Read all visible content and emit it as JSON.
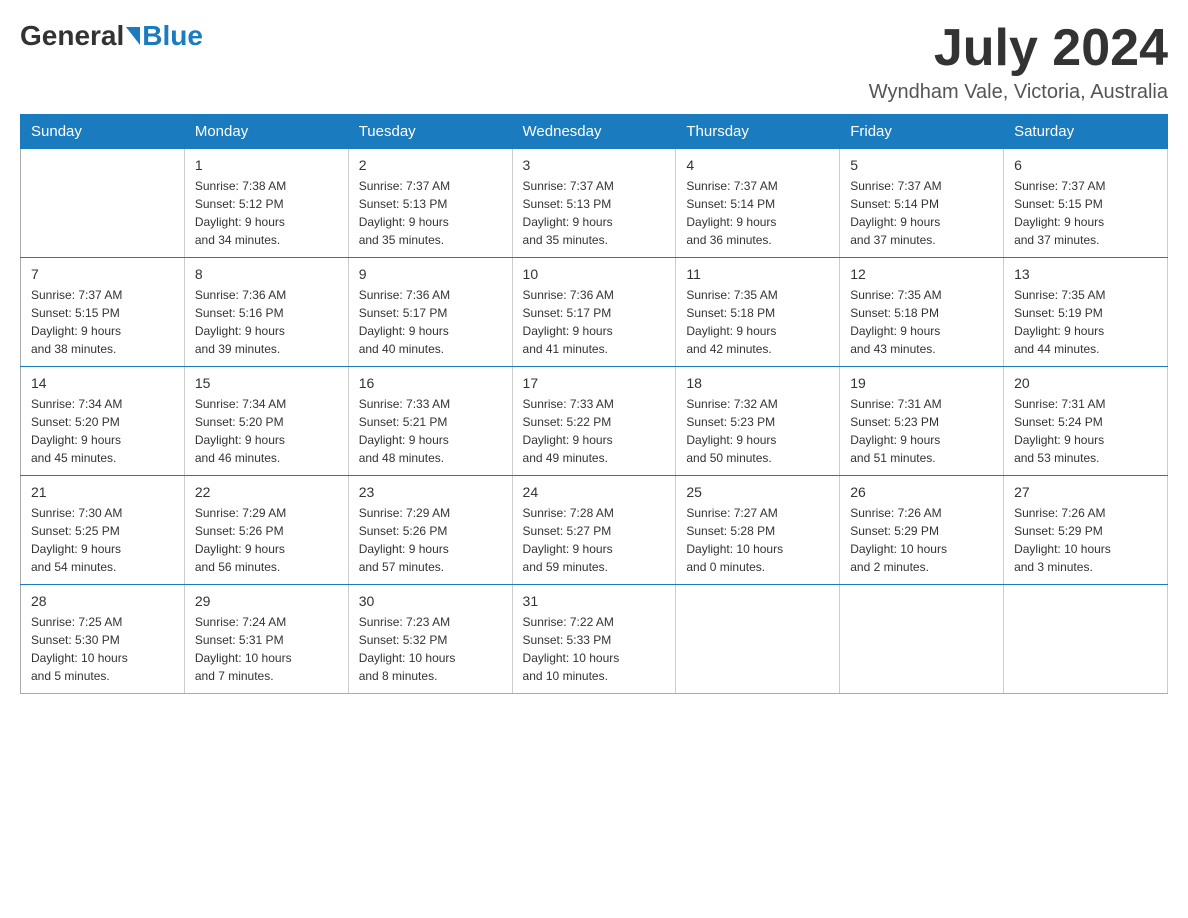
{
  "header": {
    "logo_general": "General",
    "logo_blue": "Blue",
    "month_title": "July 2024",
    "location": "Wyndham Vale, Victoria, Australia"
  },
  "weekdays": [
    "Sunday",
    "Monday",
    "Tuesday",
    "Wednesday",
    "Thursday",
    "Friday",
    "Saturday"
  ],
  "weeks": [
    [
      {
        "day": "",
        "info": ""
      },
      {
        "day": "1",
        "info": "Sunrise: 7:38 AM\nSunset: 5:12 PM\nDaylight: 9 hours\nand 34 minutes."
      },
      {
        "day": "2",
        "info": "Sunrise: 7:37 AM\nSunset: 5:13 PM\nDaylight: 9 hours\nand 35 minutes."
      },
      {
        "day": "3",
        "info": "Sunrise: 7:37 AM\nSunset: 5:13 PM\nDaylight: 9 hours\nand 35 minutes."
      },
      {
        "day": "4",
        "info": "Sunrise: 7:37 AM\nSunset: 5:14 PM\nDaylight: 9 hours\nand 36 minutes."
      },
      {
        "day": "5",
        "info": "Sunrise: 7:37 AM\nSunset: 5:14 PM\nDaylight: 9 hours\nand 37 minutes."
      },
      {
        "day": "6",
        "info": "Sunrise: 7:37 AM\nSunset: 5:15 PM\nDaylight: 9 hours\nand 37 minutes."
      }
    ],
    [
      {
        "day": "7",
        "info": "Sunrise: 7:37 AM\nSunset: 5:15 PM\nDaylight: 9 hours\nand 38 minutes."
      },
      {
        "day": "8",
        "info": "Sunrise: 7:36 AM\nSunset: 5:16 PM\nDaylight: 9 hours\nand 39 minutes."
      },
      {
        "day": "9",
        "info": "Sunrise: 7:36 AM\nSunset: 5:17 PM\nDaylight: 9 hours\nand 40 minutes."
      },
      {
        "day": "10",
        "info": "Sunrise: 7:36 AM\nSunset: 5:17 PM\nDaylight: 9 hours\nand 41 minutes."
      },
      {
        "day": "11",
        "info": "Sunrise: 7:35 AM\nSunset: 5:18 PM\nDaylight: 9 hours\nand 42 minutes."
      },
      {
        "day": "12",
        "info": "Sunrise: 7:35 AM\nSunset: 5:18 PM\nDaylight: 9 hours\nand 43 minutes."
      },
      {
        "day": "13",
        "info": "Sunrise: 7:35 AM\nSunset: 5:19 PM\nDaylight: 9 hours\nand 44 minutes."
      }
    ],
    [
      {
        "day": "14",
        "info": "Sunrise: 7:34 AM\nSunset: 5:20 PM\nDaylight: 9 hours\nand 45 minutes."
      },
      {
        "day": "15",
        "info": "Sunrise: 7:34 AM\nSunset: 5:20 PM\nDaylight: 9 hours\nand 46 minutes."
      },
      {
        "day": "16",
        "info": "Sunrise: 7:33 AM\nSunset: 5:21 PM\nDaylight: 9 hours\nand 48 minutes."
      },
      {
        "day": "17",
        "info": "Sunrise: 7:33 AM\nSunset: 5:22 PM\nDaylight: 9 hours\nand 49 minutes."
      },
      {
        "day": "18",
        "info": "Sunrise: 7:32 AM\nSunset: 5:23 PM\nDaylight: 9 hours\nand 50 minutes."
      },
      {
        "day": "19",
        "info": "Sunrise: 7:31 AM\nSunset: 5:23 PM\nDaylight: 9 hours\nand 51 minutes."
      },
      {
        "day": "20",
        "info": "Sunrise: 7:31 AM\nSunset: 5:24 PM\nDaylight: 9 hours\nand 53 minutes."
      }
    ],
    [
      {
        "day": "21",
        "info": "Sunrise: 7:30 AM\nSunset: 5:25 PM\nDaylight: 9 hours\nand 54 minutes."
      },
      {
        "day": "22",
        "info": "Sunrise: 7:29 AM\nSunset: 5:26 PM\nDaylight: 9 hours\nand 56 minutes."
      },
      {
        "day": "23",
        "info": "Sunrise: 7:29 AM\nSunset: 5:26 PM\nDaylight: 9 hours\nand 57 minutes."
      },
      {
        "day": "24",
        "info": "Sunrise: 7:28 AM\nSunset: 5:27 PM\nDaylight: 9 hours\nand 59 minutes."
      },
      {
        "day": "25",
        "info": "Sunrise: 7:27 AM\nSunset: 5:28 PM\nDaylight: 10 hours\nand 0 minutes."
      },
      {
        "day": "26",
        "info": "Sunrise: 7:26 AM\nSunset: 5:29 PM\nDaylight: 10 hours\nand 2 minutes."
      },
      {
        "day": "27",
        "info": "Sunrise: 7:26 AM\nSunset: 5:29 PM\nDaylight: 10 hours\nand 3 minutes."
      }
    ],
    [
      {
        "day": "28",
        "info": "Sunrise: 7:25 AM\nSunset: 5:30 PM\nDaylight: 10 hours\nand 5 minutes."
      },
      {
        "day": "29",
        "info": "Sunrise: 7:24 AM\nSunset: 5:31 PM\nDaylight: 10 hours\nand 7 minutes."
      },
      {
        "day": "30",
        "info": "Sunrise: 7:23 AM\nSunset: 5:32 PM\nDaylight: 10 hours\nand 8 minutes."
      },
      {
        "day": "31",
        "info": "Sunrise: 7:22 AM\nSunset: 5:33 PM\nDaylight: 10 hours\nand 10 minutes."
      },
      {
        "day": "",
        "info": ""
      },
      {
        "day": "",
        "info": ""
      },
      {
        "day": "",
        "info": ""
      }
    ]
  ]
}
